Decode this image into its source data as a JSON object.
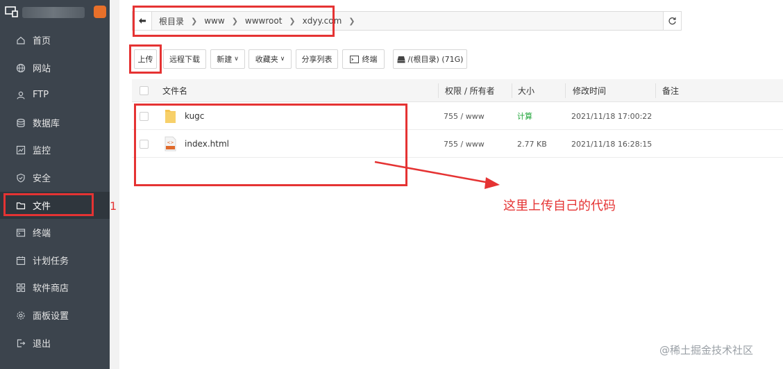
{
  "sidebar": {
    "items": [
      {
        "label": "首页",
        "icon": "home-icon"
      },
      {
        "label": "网站",
        "icon": "globe-icon"
      },
      {
        "label": "FTP",
        "icon": "ftp-user-icon"
      },
      {
        "label": "数据库",
        "icon": "database-icon"
      },
      {
        "label": "监控",
        "icon": "monitor-chart-icon"
      },
      {
        "label": "安全",
        "icon": "shield-icon"
      },
      {
        "label": "文件",
        "icon": "folder-icon"
      },
      {
        "label": "终端",
        "icon": "terminal-icon"
      },
      {
        "label": "计划任务",
        "icon": "calendar-icon"
      },
      {
        "label": "软件商店",
        "icon": "grid-icon"
      },
      {
        "label": "面板设置",
        "icon": "gear-icon"
      },
      {
        "label": "退出",
        "icon": "logout-icon"
      }
    ],
    "active_label": "文件"
  },
  "path": {
    "crumbs": [
      "根目录",
      "www",
      "wwwroot",
      "xdyy.com"
    ]
  },
  "toolbar": {
    "upload": "上传",
    "remote_download": "远程下载",
    "new": "新建",
    "favorites": "收藏夹",
    "share_list": "分享列表",
    "terminal": "终端",
    "disk": "/(根目录) (71G)"
  },
  "table": {
    "columns": {
      "name": "文件名",
      "perm": "权限 / 所有者",
      "size": "大小",
      "mtime": "修改时间",
      "note": "备注"
    },
    "rows": [
      {
        "name": "kugc",
        "type": "folder",
        "perm": "755 / www",
        "size": "计算",
        "mtime": "2021/11/18 17:00:22"
      },
      {
        "name": "index.html",
        "type": "html",
        "perm": "755 / www",
        "size": "2.77 KB",
        "mtime": "2021/11/18 16:28:15"
      }
    ]
  },
  "annotations": {
    "number": "1",
    "text": "这里上传自己的代码",
    "watermark": "@稀土掘金技术社区",
    "color": "#e53333"
  }
}
